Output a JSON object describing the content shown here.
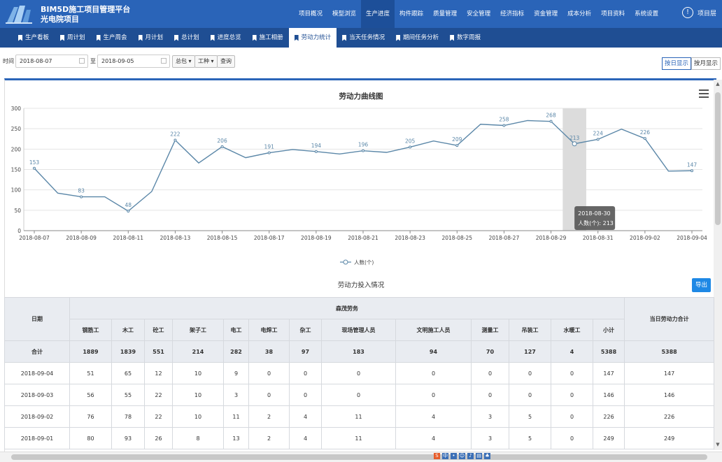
{
  "app": {
    "title": "BIM5D施工项目管理平台",
    "subtitle": "光电院项目",
    "user_label": "项目层",
    "top_nav": [
      "项目概况",
      "模型浏览",
      "生产进度",
      "构件跟踪",
      "质量管理",
      "安全管理",
      "经济指标",
      "资金管理",
      "成本分析",
      "项目资料",
      "系统设置"
    ],
    "top_nav_active": 2,
    "sub_nav": [
      "生产看板",
      "周计划",
      "生产周会",
      "月计划",
      "总计划",
      "进度总览",
      "施工相册",
      "劳动力统计",
      "当天任务情况",
      "期间任务分析",
      "数字周报"
    ],
    "sub_nav_active": 7
  },
  "filters": {
    "time_label": "时间",
    "start_date": "2018-08-07",
    "to_label": "至",
    "end_date": "2018-09-05",
    "contractor_btn": "总包 ▾",
    "worktype_btn": "工种 ▾",
    "query_btn": "查询",
    "view_daily": "按日显示",
    "view_monthly": "按月显示"
  },
  "chart_data": {
    "type": "line",
    "title": "劳动力曲线图",
    "legend": [
      "人数(个)"
    ],
    "ylim": [
      0,
      300
    ],
    "yticks": [
      0,
      50,
      100,
      150,
      200,
      250,
      300
    ],
    "x_tick_labels": [
      "2018-08-07",
      "2018-08-09",
      "2018-08-11",
      "2018-08-13",
      "2018-08-15",
      "2018-08-17",
      "2018-08-19",
      "2018-08-21",
      "2018-08-23",
      "2018-08-25",
      "2018-08-27",
      "2018-08-29",
      "2018-08-31",
      "2018-09-02",
      "2018-09-04"
    ],
    "x": [
      "2018-08-07",
      "2018-08-08",
      "2018-08-09",
      "2018-08-10",
      "2018-08-11",
      "2018-08-12",
      "2018-08-13",
      "2018-08-14",
      "2018-08-15",
      "2018-08-16",
      "2018-08-17",
      "2018-08-18",
      "2018-08-19",
      "2018-08-20",
      "2018-08-21",
      "2018-08-22",
      "2018-08-23",
      "2018-08-24",
      "2018-08-25",
      "2018-08-26",
      "2018-08-27",
      "2018-08-28",
      "2018-08-29",
      "2018-08-30",
      "2018-08-31",
      "2018-09-01",
      "2018-09-02",
      "2018-09-03",
      "2018-09-04"
    ],
    "series": [
      {
        "name": "人数(个)",
        "values": [
          153,
          92,
          83,
          83,
          48,
          96,
          222,
          166,
          206,
          179,
          191,
          199,
          194,
          188,
          196,
          192,
          205,
          220,
          209,
          261,
          258,
          270,
          268,
          213,
          224,
          249,
          226,
          146,
          147
        ],
        "labeled": [
          153,
          null,
          83,
          null,
          48,
          null,
          222,
          null,
          206,
          null,
          191,
          null,
          194,
          null,
          196,
          null,
          205,
          null,
          209,
          null,
          258,
          null,
          268,
          213,
          224,
          null,
          226,
          null,
          147
        ]
      }
    ],
    "highlight_index": 23,
    "tooltip": {
      "date": "2018-08-30",
      "text": "人数(个): 213"
    },
    "color": "#5b87a8"
  },
  "table": {
    "section_title": "劳动力投入情况",
    "export_label": "导出",
    "date_header": "日期",
    "group_header": "森茂劳务",
    "total_header": "当日劳动力合计",
    "columns": [
      "钢筋工",
      "木工",
      "砼工",
      "架子工",
      "电工",
      "电焊工",
      "杂工",
      "现场管理人员",
      "文明施工人员",
      "测量工",
      "吊装工",
      "水暖工",
      "小计"
    ],
    "sum_row": {
      "label": "合计",
      "values": [
        "1889",
        "1839",
        "551",
        "214",
        "282",
        "38",
        "97",
        "183",
        "94",
        "70",
        "127",
        "4",
        "5388"
      ],
      "total": "5388"
    },
    "rows": [
      {
        "date": "2018-09-04",
        "values": [
          "51",
          "65",
          "12",
          "10",
          "9",
          "0",
          "0",
          "0",
          "0",
          "0",
          "0",
          "0",
          "147"
        ],
        "total": "147"
      },
      {
        "date": "2018-09-03",
        "values": [
          "56",
          "55",
          "22",
          "10",
          "3",
          "0",
          "0",
          "0",
          "0",
          "0",
          "0",
          "0",
          "146"
        ],
        "total": "146"
      },
      {
        "date": "2018-09-02",
        "values": [
          "76",
          "78",
          "22",
          "10",
          "11",
          "2",
          "4",
          "11",
          "4",
          "3",
          "5",
          "0",
          "226"
        ],
        "total": "226"
      },
      {
        "date": "2018-09-01",
        "values": [
          "80",
          "93",
          "26",
          "8",
          "13",
          "2",
          "4",
          "11",
          "4",
          "3",
          "5",
          "0",
          "249"
        ],
        "total": "249"
      }
    ]
  }
}
